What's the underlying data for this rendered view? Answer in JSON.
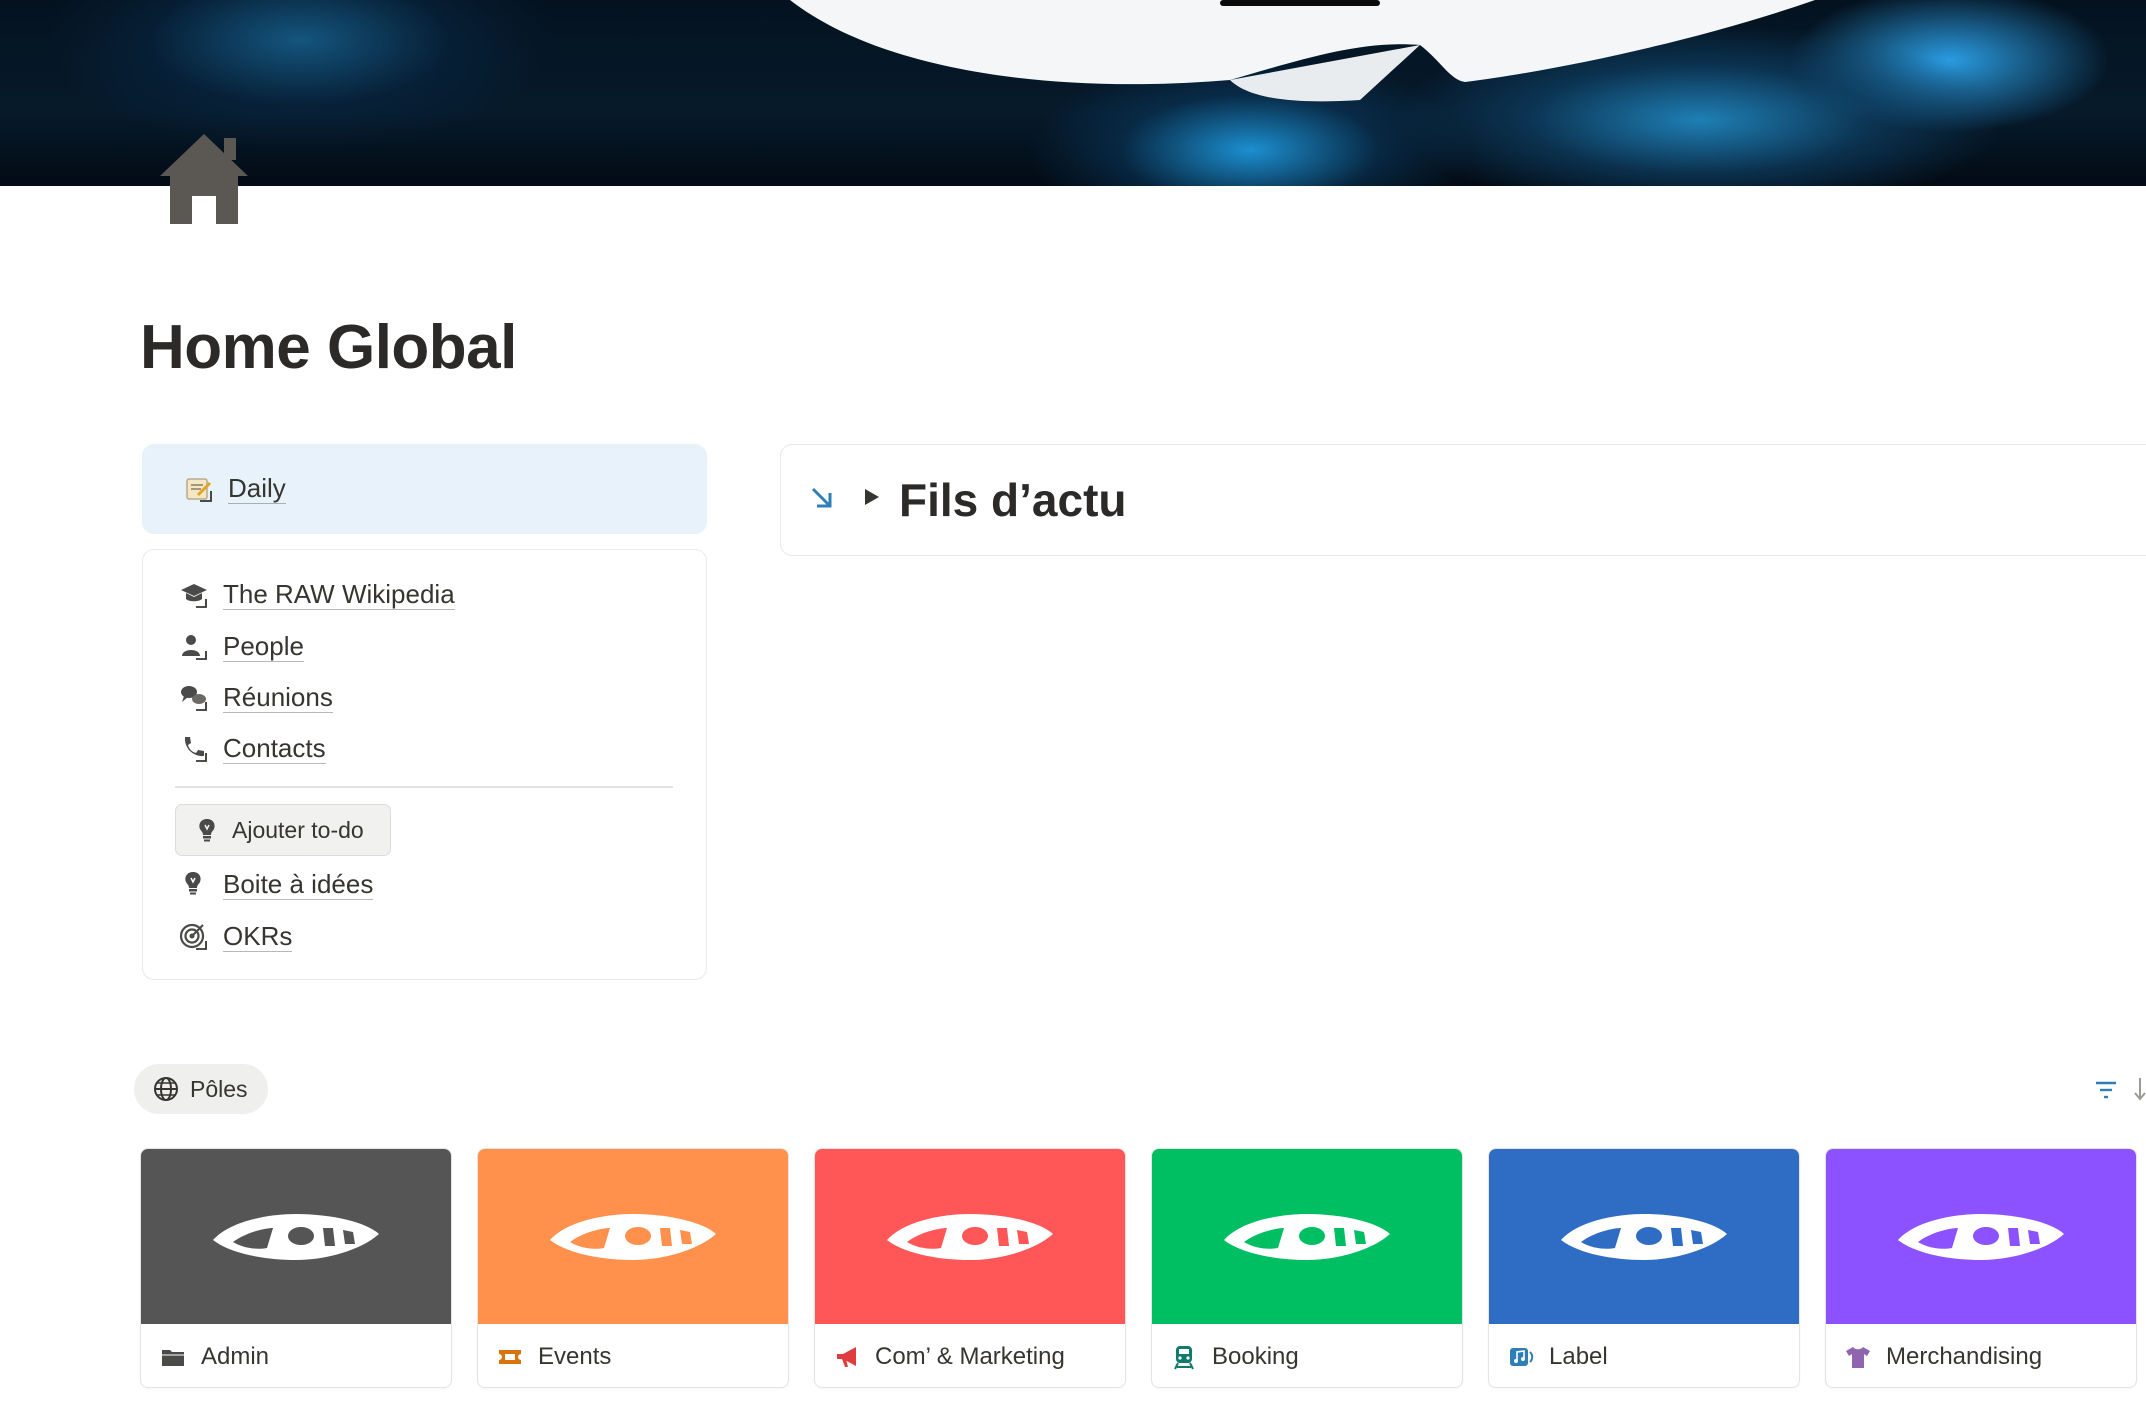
{
  "page": {
    "title": "Home Global"
  },
  "daily": {
    "label": "Daily",
    "icon": "memo-arrow-icon",
    "bg_color": "#e7f2fb"
  },
  "nav": {
    "items": [
      {
        "label": "The RAW Wikipedia",
        "icon": "graduation-cap-icon"
      },
      {
        "label": "People",
        "icon": "person-icon"
      },
      {
        "label": "Réunions",
        "icon": "speech-bubbles-icon"
      },
      {
        "label": "Contacts",
        "icon": "phone-icon"
      }
    ],
    "todo_button": {
      "label": "Ajouter to-do",
      "icon": "lightbulb-icon"
    },
    "bottom_items": [
      {
        "label": "Boite à idées",
        "icon": "lightbulb-icon"
      },
      {
        "label": "OKRs",
        "icon": "target-icon"
      }
    ]
  },
  "fils": {
    "title": "Fils d’actu",
    "arrow_color": "#2e7fb8"
  },
  "poles": {
    "tab_label": "Pôles",
    "cards": [
      {
        "label": "Admin",
        "color": "#555555",
        "icon": "folder-icon",
        "icon_color": "#4a4a48"
      },
      {
        "label": "Events",
        "color": "#ff914d",
        "icon": "ticket-icon",
        "icon_color": "#d9730d"
      },
      {
        "label": "Com’ & Marketing",
        "color": "#ff5757",
        "icon": "megaphone-icon",
        "icon_color": "#e03e3e"
      },
      {
        "label": "Booking",
        "color": "#00bf63",
        "icon": "train-icon",
        "icon_color": "#0f7b6c"
      },
      {
        "label": "Label",
        "color": "#2f6dc4",
        "icon": "music-note-icon",
        "icon_color": "#2e7fb8"
      },
      {
        "label": "Merchandising",
        "color": "#8c52ff",
        "icon": "tshirt-icon",
        "icon_color": "#9065b0"
      }
    ]
  }
}
